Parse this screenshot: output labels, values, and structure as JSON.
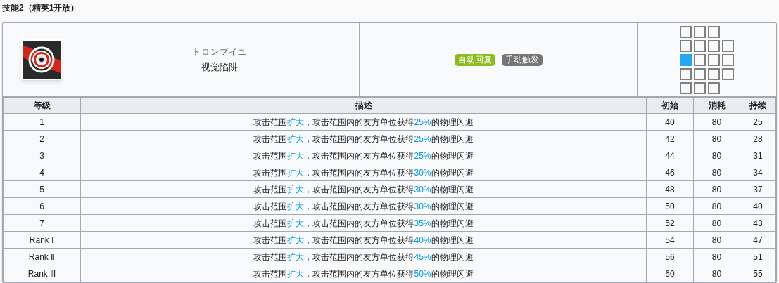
{
  "section_title": "技能2（精英1开放）",
  "skill": {
    "name_ja": "トロンプイユ",
    "name": "视觉陷阱",
    "tags": [
      {
        "label": "自动回复",
        "color": "#8cba22"
      },
      {
        "label": "手动触发",
        "color": "#757575"
      }
    ],
    "range": [
      [
        {
          "selected": false
        },
        {
          "selected": false
        },
        {
          "selected": false
        }
      ],
      [
        {
          "selected": false
        },
        {
          "selected": false
        },
        {
          "selected": false
        },
        {
          "selected": false
        }
      ],
      [
        {
          "selected": true
        },
        {
          "selected": false
        },
        {
          "selected": false
        },
        {
          "selected": false
        }
      ],
      [
        {
          "selected": false
        },
        {
          "selected": false
        },
        {
          "selected": false
        },
        {
          "selected": false
        }
      ],
      [
        {
          "selected": false
        },
        {
          "selected": false
        },
        {
          "selected": false
        }
      ]
    ]
  },
  "table": {
    "columns": [
      "等级",
      "描述",
      "初始",
      "消耗",
      "持续"
    ],
    "rows": [
      {
        "level": "1",
        "description": [
          {
            "text": "攻击范围"
          },
          {
            "text": "扩大",
            "highlight": true
          },
          {
            "text": "，攻击范围内的友方单位获得"
          },
          {
            "text": "25%",
            "highlight": true
          },
          {
            "text": "的物理闪避"
          }
        ],
        "initial": "40",
        "cost": "80",
        "duration": "25"
      },
      {
        "level": "2",
        "description": [
          {
            "text": "攻击范围"
          },
          {
            "text": "扩大",
            "highlight": true
          },
          {
            "text": "，攻击范围内的友方单位获得"
          },
          {
            "text": "25%",
            "highlight": true
          },
          {
            "text": "的物理闪避"
          }
        ],
        "initial": "42",
        "cost": "80",
        "duration": "28"
      },
      {
        "level": "3",
        "description": [
          {
            "text": "攻击范围"
          },
          {
            "text": "扩大",
            "highlight": true
          },
          {
            "text": "，攻击范围内的友方单位获得"
          },
          {
            "text": "25%",
            "highlight": true
          },
          {
            "text": "的物理闪避"
          }
        ],
        "initial": "44",
        "cost": "80",
        "duration": "31"
      },
      {
        "level": "4",
        "description": [
          {
            "text": "攻击范围"
          },
          {
            "text": "扩大",
            "highlight": true
          },
          {
            "text": "，攻击范围内的友方单位获得"
          },
          {
            "text": "30%",
            "highlight": true
          },
          {
            "text": "的物理闪避"
          }
        ],
        "initial": "46",
        "cost": "80",
        "duration": "34"
      },
      {
        "level": "5",
        "description": [
          {
            "text": "攻击范围"
          },
          {
            "text": "扩大",
            "highlight": true
          },
          {
            "text": "，攻击范围内的友方单位获得"
          },
          {
            "text": "30%",
            "highlight": true
          },
          {
            "text": "的物理闪避"
          }
        ],
        "initial": "48",
        "cost": "80",
        "duration": "37"
      },
      {
        "level": "6",
        "description": [
          {
            "text": "攻击范围"
          },
          {
            "text": "扩大",
            "highlight": true
          },
          {
            "text": "，攻击范围内的友方单位获得"
          },
          {
            "text": "30%",
            "highlight": true
          },
          {
            "text": "的物理闪避"
          }
        ],
        "initial": "50",
        "cost": "80",
        "duration": "40"
      },
      {
        "level": "7",
        "description": [
          {
            "text": "攻击范围"
          },
          {
            "text": "扩大",
            "highlight": true
          },
          {
            "text": "，攻击范围内的友方单位获得"
          },
          {
            "text": "35%",
            "highlight": true
          },
          {
            "text": "的物理闪避"
          }
        ],
        "initial": "52",
        "cost": "80",
        "duration": "43"
      },
      {
        "level": "Rank Ⅰ",
        "description": [
          {
            "text": "攻击范围"
          },
          {
            "text": "扩大",
            "highlight": true
          },
          {
            "text": "，攻击范围内的友方单位获得"
          },
          {
            "text": "40%",
            "highlight": true
          },
          {
            "text": "的物理闪避"
          }
        ],
        "initial": "54",
        "cost": "80",
        "duration": "47"
      },
      {
        "level": "Rank Ⅱ",
        "description": [
          {
            "text": "攻击范围"
          },
          {
            "text": "扩大",
            "highlight": true
          },
          {
            "text": "，攻击范围内的友方单位获得"
          },
          {
            "text": "45%",
            "highlight": true
          },
          {
            "text": "的物理闪避"
          }
        ],
        "initial": "56",
        "cost": "80",
        "duration": "51"
      },
      {
        "level": "Rank Ⅲ",
        "description": [
          {
            "text": "攻击范围"
          },
          {
            "text": "扩大",
            "highlight": true
          },
          {
            "text": "，攻击范围内的友方单位获得"
          },
          {
            "text": "50%",
            "highlight": true
          },
          {
            "text": "的物理闪避"
          }
        ],
        "initial": "60",
        "cost": "80",
        "duration": "55"
      }
    ]
  }
}
